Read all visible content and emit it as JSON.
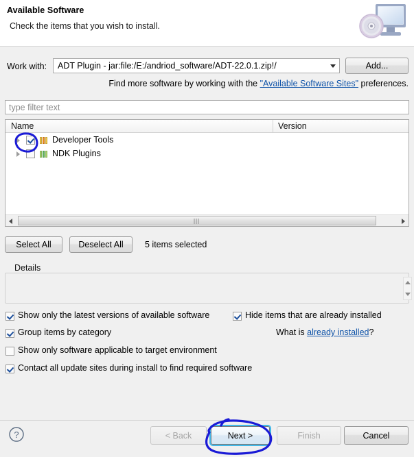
{
  "banner": {
    "title": "Available Software",
    "subtitle": "Check the items that you wish to install.",
    "icon": "install-monitor-disc-icon"
  },
  "work_with": {
    "label": "Work with:",
    "value": "ADT Plugin - jar:file:/E:/andriod_software/ADT-22.0.1.zip!/",
    "dropdown_icon": "chevron-down-icon",
    "add_button": "Add..."
  },
  "find_more": {
    "prefix": "Find more software by working with the ",
    "link": "\"Available Software Sites\"",
    "suffix": " preferences."
  },
  "filter": {
    "value": "",
    "placeholder": "type filter text"
  },
  "tree": {
    "columns": [
      "Name",
      "Version"
    ],
    "rows": [
      {
        "name": "Developer Tools",
        "version": "",
        "checked": true,
        "expanded": false,
        "icon": "feature-category-icon",
        "icon_colors": [
          "#f5c842",
          "#f08c1e",
          "#f5c842"
        ]
      },
      {
        "name": "NDK Plugins",
        "version": "",
        "checked": false,
        "expanded": false,
        "icon": "feature-category-icon",
        "icon_colors": [
          "#a8d86a",
          "#5fb85f",
          "#a8d86a"
        ]
      }
    ]
  },
  "selection_bar": {
    "select_all": "Select All",
    "deselect_all": "Deselect All",
    "status": "5 items selected"
  },
  "details": {
    "legend": "Details",
    "content": ""
  },
  "options": [
    {
      "label": "Show only the latest versions of available software",
      "checked": true
    },
    {
      "label": "Group items by category",
      "checked": true
    },
    {
      "label": "Show only software applicable to target environment",
      "checked": false
    },
    {
      "label": "Contact all update sites during install to find required software",
      "checked": true
    },
    {
      "label": "Hide items that are already installed",
      "checked": true
    }
  ],
  "what_is": {
    "prefix": "What is ",
    "link": "already installed",
    "suffix": "?"
  },
  "footer": {
    "help_icon": "help-question-icon",
    "back": "< Back",
    "next": "Next >",
    "finish": "Finish",
    "cancel": "Cancel"
  },
  "annotations": {
    "color": "#1a1ad6",
    "marks": [
      "circle-around-developer-tools-checkbox",
      "circle-around-next-button"
    ]
  }
}
